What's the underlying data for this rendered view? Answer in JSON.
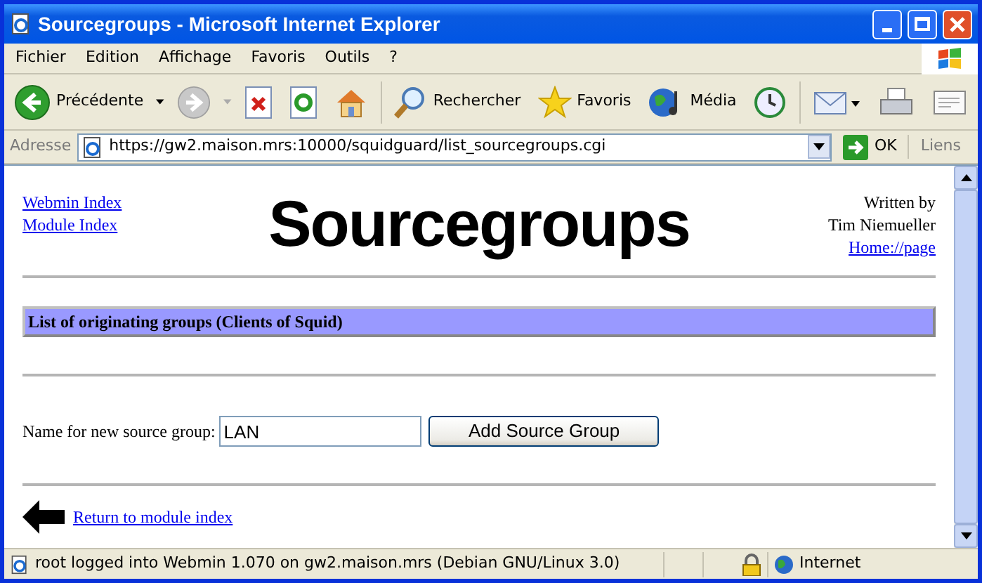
{
  "window": {
    "title": "Sourcegroups - Microsoft Internet Explorer"
  },
  "menu": [
    "Fichier",
    "Edition",
    "Affichage",
    "Favoris",
    "Outils",
    "?"
  ],
  "toolbar": [
    {
      "kind": "back",
      "label": "Précédente"
    },
    {
      "kind": "forward"
    },
    {
      "kind": "stop"
    },
    {
      "kind": "refresh"
    },
    {
      "kind": "home"
    },
    {
      "kind": "search",
      "label": "Rechercher"
    },
    {
      "kind": "favorites",
      "label": "Favoris"
    },
    {
      "kind": "media",
      "label": "Média"
    },
    {
      "kind": "history"
    },
    {
      "kind": "mail"
    },
    {
      "kind": "print"
    },
    {
      "kind": "edit"
    }
  ],
  "address_bar": {
    "label": "Adresse",
    "url": "https://gw2.maison.mrs:10000/squidguard/list_sourcegroups.cgi",
    "go": "OK",
    "links": "Liens"
  },
  "page": {
    "nav_links": [
      "Webmin Index",
      "Module Index"
    ],
    "title": "Sourcegroups",
    "author": [
      "Written by",
      "Tim Niemueller"
    ],
    "author_link": "Home://page",
    "section_header": "List of originating groups (Clients of Squid)",
    "form": {
      "label": "Name for new source group:",
      "value": "LAN",
      "button": "Add Source Group"
    },
    "back_link": "Return to module index"
  },
  "status_bar": {
    "text": "root logged into Webmin 1.070 on gw2.maison.mrs (Debian GNU/Linux 3.0)",
    "zone": "Internet"
  }
}
